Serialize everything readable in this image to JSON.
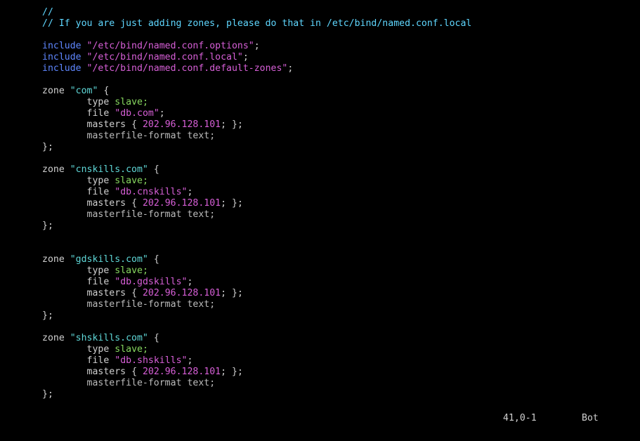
{
  "editor": {
    "comment_lines": [
      "//",
      "// If you are just adding zones, please do that in /etc/bind/named.conf.local"
    ],
    "includes": [
      {
        "keyword": "include",
        "path": "\"/etc/bind/named.conf.options\"",
        "end": ";"
      },
      {
        "keyword": "include",
        "path": "\"/etc/bind/named.conf.local\"",
        "end": ";"
      },
      {
        "keyword": "include",
        "path": "\"/etc/bind/named.conf.default-zones\"",
        "end": ";"
      }
    ],
    "zones": [
      {
        "keyword": "zone",
        "name": "\"com\"",
        "open": "{",
        "type_kw": "type",
        "type_val": "slave;",
        "file_kw": "file",
        "file_val": "\"db.com\"",
        "file_end": ";",
        "masters_kw": "masters",
        "masters_open": "{",
        "masters_ip": "202.96.128.101",
        "masters_close": "; };",
        "format_line": "masterfile-format text;",
        "close": "};"
      },
      {
        "keyword": "zone",
        "name": "\"cnskills.com\"",
        "open": "{",
        "type_kw": "type",
        "type_val": "slave;",
        "file_kw": "file",
        "file_val": "\"db.cnskills\"",
        "file_end": ";",
        "masters_kw": "masters",
        "masters_open": "{",
        "masters_ip": "202.96.128.101",
        "masters_close": "; };",
        "format_line": "masterfile-format text;",
        "close": "};"
      },
      {
        "keyword": "zone",
        "name": "\"gdskills.com\"",
        "open": "{",
        "type_kw": "type",
        "type_val": "slave;",
        "file_kw": "file",
        "file_val": "\"db.gdskills\"",
        "file_end": ";",
        "masters_kw": "masters",
        "masters_open": "{",
        "masters_ip": "202.96.128.101",
        "masters_close": "; };",
        "format_line": "masterfile-format text;",
        "close": "};"
      },
      {
        "keyword": "zone",
        "name": "\"shskills.com\"",
        "open": "{",
        "type_kw": "type",
        "type_val": "slave;",
        "file_kw": "file",
        "file_val": "\"db.shskills\"",
        "file_end": ";",
        "masters_kw": "masters",
        "masters_open": "{",
        "masters_ip": "202.96.128.101",
        "masters_close": "; };",
        "format_line": "masterfile-format text;",
        "close": "};"
      }
    ]
  },
  "status": {
    "cursor_position": "41,0-1",
    "scroll_position": "Bot"
  },
  "colors": {
    "background": "#000000",
    "comment": "#5fd7ff",
    "include_keyword": "#5f87ff",
    "string": "#d75fd7",
    "type_value": "#87d75f",
    "text": "#d0d0d0"
  }
}
